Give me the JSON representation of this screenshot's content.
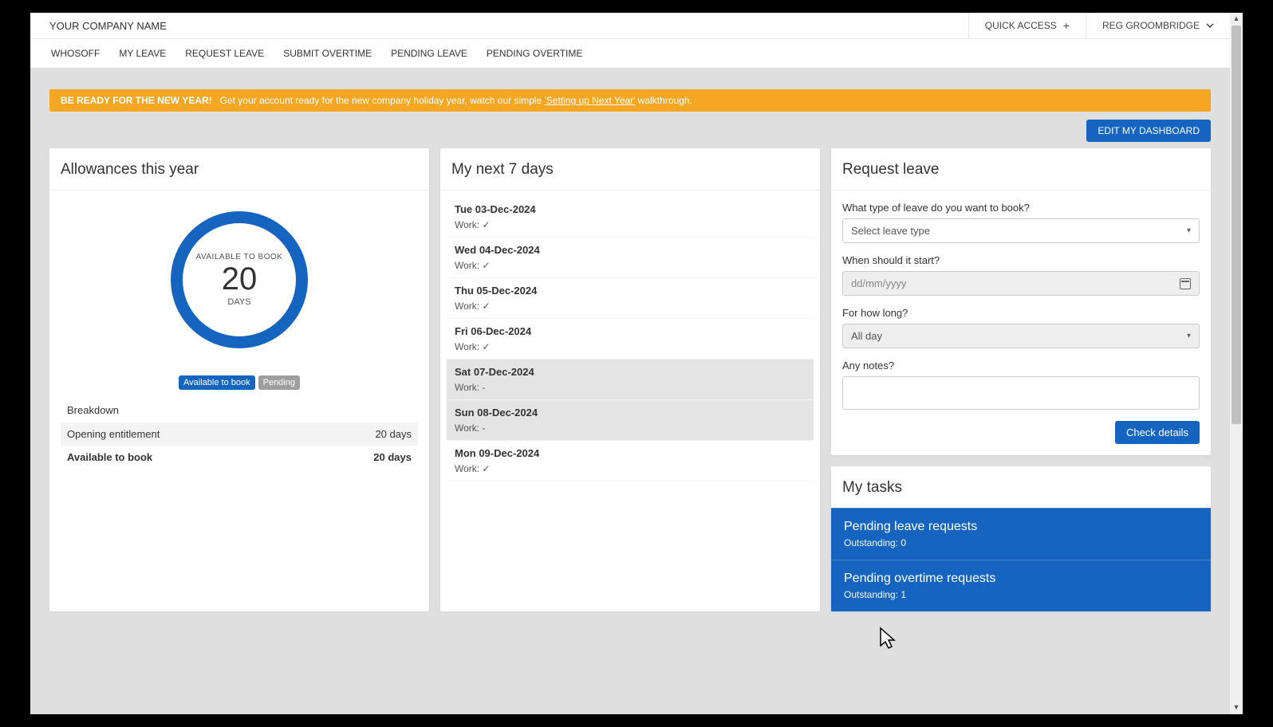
{
  "header": {
    "company": "YOUR COMPANY NAME",
    "quick_access": "QUICK ACCESS",
    "user": "REG GROOMBRIDGE"
  },
  "nav": {
    "items": [
      "WHOSOFF",
      "MY LEAVE",
      "REQUEST LEAVE",
      "SUBMIT OVERTIME",
      "PENDING LEAVE",
      "PENDING OVERTIME"
    ]
  },
  "banner": {
    "bold": "BE READY FOR THE NEW YEAR!",
    "text_before": "Get your account ready for the new company holiday year, watch our simple ",
    "link": "'Setting up Next Year'",
    "text_after": " walkthrough."
  },
  "edit_button": "EDIT MY DASHBOARD",
  "allowances": {
    "title": "Allowances this year",
    "donut_top": "AVAILABLE TO BOOK",
    "donut_value": "20",
    "donut_bottom": "DAYS",
    "legend_available": "Available to book",
    "legend_pending": "Pending",
    "breakdown_title": "Breakdown",
    "rows": [
      {
        "label": "Opening entitlement",
        "value": "20 days"
      },
      {
        "label": "Available to book",
        "value": "20 days"
      }
    ]
  },
  "next7": {
    "title": "My next 7 days",
    "days": [
      {
        "date": "Tue 03-Dec-2024",
        "work": "Work: ✓",
        "weekend": false
      },
      {
        "date": "Wed 04-Dec-2024",
        "work": "Work: ✓",
        "weekend": false
      },
      {
        "date": "Thu 05-Dec-2024",
        "work": "Work: ✓",
        "weekend": false
      },
      {
        "date": "Fri 06-Dec-2024",
        "work": "Work: ✓",
        "weekend": false
      },
      {
        "date": "Sat 07-Dec-2024",
        "work": "Work: -",
        "weekend": true
      },
      {
        "date": "Sun 08-Dec-2024",
        "work": "Work: -",
        "weekend": true
      },
      {
        "date": "Mon 09-Dec-2024",
        "work": "Work: ✓",
        "weekend": false
      }
    ]
  },
  "request": {
    "title": "Request leave",
    "q_type": "What type of leave do you want to book?",
    "type_placeholder": "Select leave type",
    "q_start": "When should it start?",
    "start_placeholder": "dd/mm/yyyy",
    "q_duration": "For how long?",
    "duration_value": "All day",
    "q_notes": "Any notes?",
    "submit": "Check details"
  },
  "tasks": {
    "title": "My tasks",
    "items": [
      {
        "title": "Pending leave requests",
        "sub": "Outstanding: 0"
      },
      {
        "title": "Pending overtime requests",
        "sub": "Outstanding: 1"
      }
    ]
  }
}
